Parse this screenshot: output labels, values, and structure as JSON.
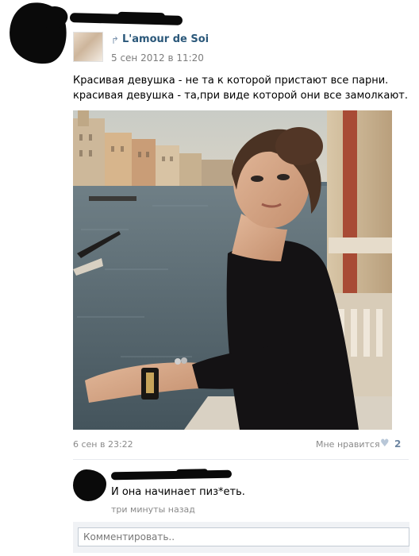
{
  "repost": {
    "source_name": "L'amour de Soi",
    "source_date": "5 сен 2012 в 11:20",
    "repost_icon": "repost-arrow-icon"
  },
  "post": {
    "text_lines": [
      "Красивая девушка - не та к которой пристают все парни.",
      "красивая девушка - та,при виде которой они все замолкают."
    ]
  },
  "footer": {
    "date": "6 сен в 23:22",
    "like_label": "Мне нравится",
    "like_icon": "heart-icon",
    "like_count": "2"
  },
  "comments": [
    {
      "text": "И она начинает пиз*еть.",
      "time": "три минуты назад"
    }
  ],
  "comment_input": {
    "placeholder": "Комментировать.."
  },
  "colors": {
    "link_blue": "#2b587a",
    "meta_gray": "#8a8a8a",
    "like_blue": "#6d86a2",
    "input_bg": "#f0f2f5"
  }
}
